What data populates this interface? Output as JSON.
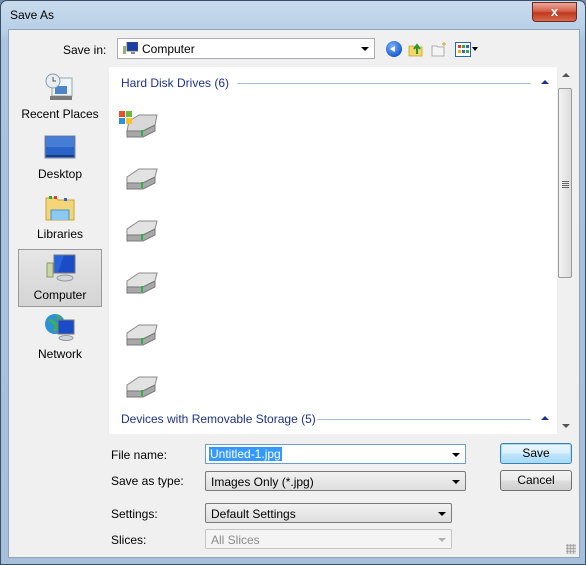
{
  "window": {
    "title": "Save As",
    "close_label": "x"
  },
  "toolbar": {
    "save_in_label": "Save in:",
    "save_in_value": "Computer",
    "icons": [
      "back-icon",
      "up-folder-icon",
      "new-folder-icon",
      "views-menu-icon"
    ]
  },
  "places": [
    {
      "label": "Recent Places",
      "icon": "recent-places-icon",
      "selected": false
    },
    {
      "label": "Desktop",
      "icon": "desktop-icon",
      "selected": false
    },
    {
      "label": "Libraries",
      "icon": "libraries-icon",
      "selected": false
    },
    {
      "label": "Computer",
      "icon": "computer-icon",
      "selected": true
    },
    {
      "label": "Network",
      "icon": "network-icon",
      "selected": false
    }
  ],
  "browser": {
    "groups": [
      {
        "title": "Hard Disk Drives (6)",
        "count": 6,
        "items": [
          "system-drive",
          "drive",
          "drive",
          "drive",
          "drive",
          "drive"
        ]
      },
      {
        "title": "Devices with Removable Storage (5)",
        "count": 5
      }
    ]
  },
  "form": {
    "file_name_label": "File name:",
    "file_name_value": "Untitled-1.jpg",
    "save_type_label": "Save as type:",
    "save_type_value": "Images Only (*.jpg)",
    "settings_label": "Settings:",
    "settings_value": "Default Settings",
    "slices_label": "Slices:",
    "slices_value": "All Slices"
  },
  "buttons": {
    "save": "Save",
    "cancel": "Cancel"
  }
}
